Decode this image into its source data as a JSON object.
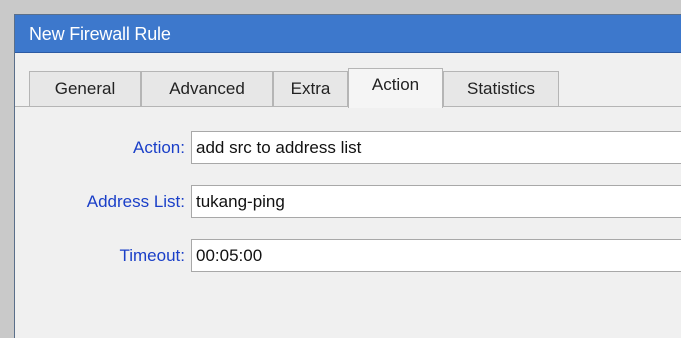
{
  "window": {
    "title": "New Firewall Rule"
  },
  "tabs": [
    {
      "label": "General",
      "active": false
    },
    {
      "label": "Advanced",
      "active": false
    },
    {
      "label": "Extra",
      "active": false
    },
    {
      "label": "Action",
      "active": true
    },
    {
      "label": "Statistics",
      "active": false
    }
  ],
  "form": {
    "action_label": "Action:",
    "action_value": "add src to address list",
    "address_list_label": "Address List:",
    "address_list_value": "tukang-ping",
    "timeout_label": "Timeout:",
    "timeout_value": "00:05:00"
  },
  "colors": {
    "titlebar": "#3d78cc",
    "label_text": "#1a3fc8",
    "panel_bg": "#f0f0f0"
  }
}
